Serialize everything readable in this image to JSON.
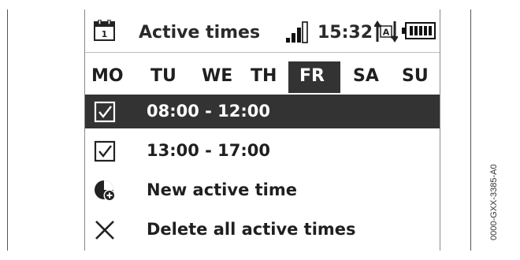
{
  "header": {
    "title": "Active times",
    "time": "15:32",
    "calendar_icon_day": "1",
    "auto_icon_letter": "A"
  },
  "days": [
    {
      "label": "MO",
      "selected": false
    },
    {
      "label": "TU",
      "selected": false
    },
    {
      "label": "WE",
      "selected": false
    },
    {
      "label": "TH",
      "selected": false
    },
    {
      "label": "FR",
      "selected": true
    },
    {
      "label": "SA",
      "selected": false
    },
    {
      "label": "SU",
      "selected": false
    }
  ],
  "rows": [
    {
      "label": "08:00 - 12:00",
      "icon": "checkbox-checked-icon",
      "selected": true
    },
    {
      "label": "13:00 - 17:00",
      "icon": "checkbox-checked-icon",
      "selected": false
    },
    {
      "label": "New active time",
      "icon": "clock-add-icon",
      "selected": false
    },
    {
      "label": "Delete all active times",
      "icon": "close-icon",
      "selected": false
    }
  ],
  "side_code": "0000-GXX-3385-A0",
  "colors": {
    "highlight": "#333333",
    "text": "#1f1f1f"
  }
}
